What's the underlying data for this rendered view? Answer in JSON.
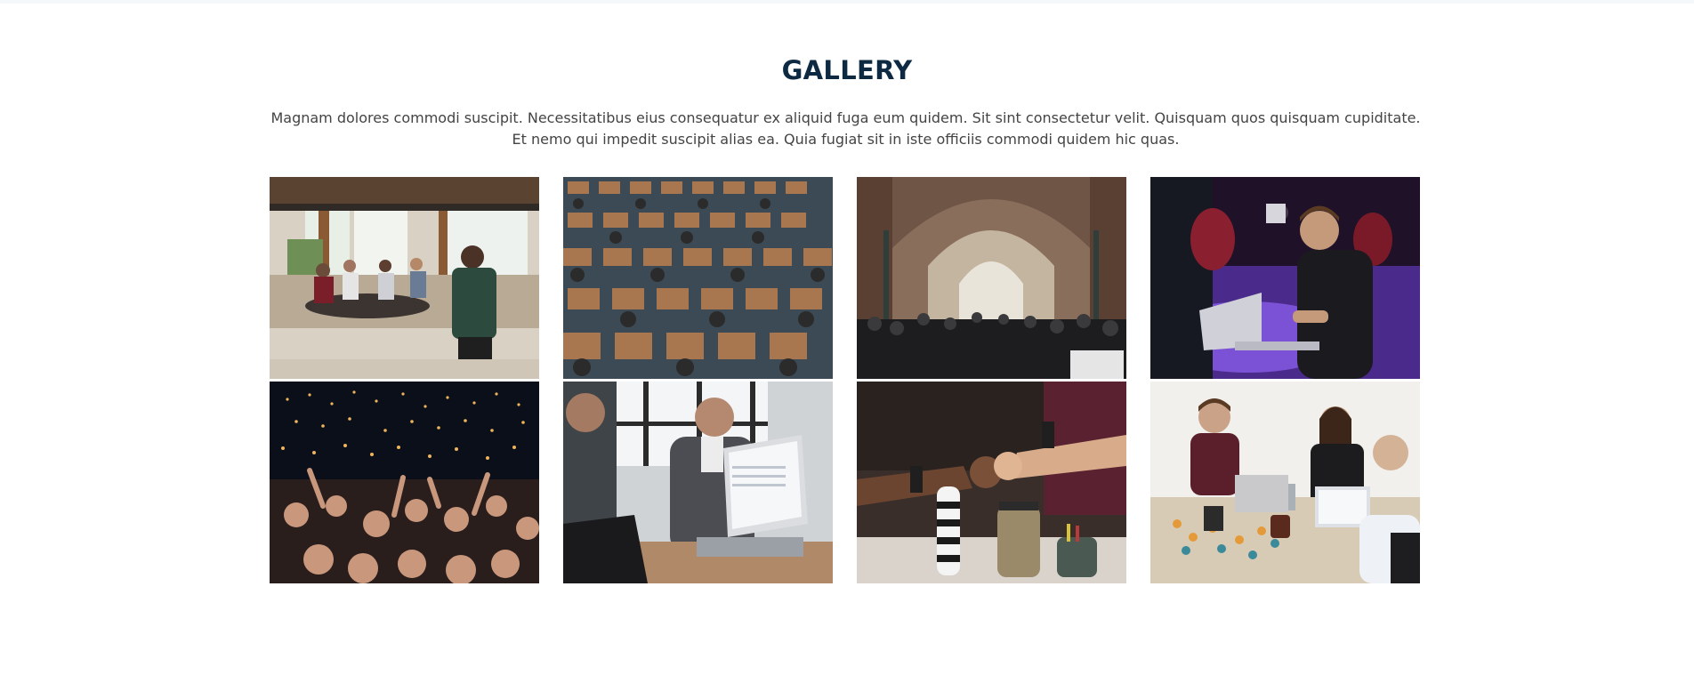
{
  "gallery": {
    "title": "GALLERY",
    "description": "Magnam dolores commodi suscipit. Necessitatibus eius consequatur ex aliquid fuga eum quidem. Sit sint consectetur velit. Quisquam quos quisquam cupiditate. Et nemo qui impedit suscipit alias ea. Quia fugiat sit in iste officiis commodi quidem hic quas.",
    "images": [
      {
        "name": "gallery-image-restaurant-talk",
        "scene": "speaker addressing diners in a restaurant"
      },
      {
        "name": "gallery-image-auditorium",
        "scene": "audience seated in auditorium"
      },
      {
        "name": "gallery-image-exhibition-hall",
        "scene": "crowd in arched exhibition hall"
      },
      {
        "name": "gallery-image-laptop-purple",
        "scene": "man using laptop under purple light"
      },
      {
        "name": "gallery-image-concert-crowd",
        "scene": "concert crowd with raised hands"
      },
      {
        "name": "gallery-image-office-meeting",
        "scene": "colleagues at laptops in office"
      },
      {
        "name": "gallery-image-fist-bump",
        "scene": "team fist bump over table"
      },
      {
        "name": "gallery-image-team-table",
        "scene": "team working at table with laptops"
      }
    ]
  },
  "colors": {
    "title": "#0e2a42",
    "text": "#444444",
    "background": "#ffffff"
  }
}
